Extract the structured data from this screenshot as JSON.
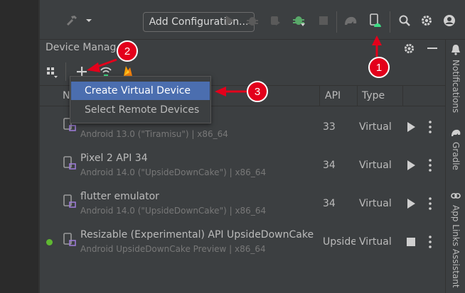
{
  "toolbar": {
    "add_configuration_label": "Add Configuration..."
  },
  "panel": {
    "title": "Device Manager"
  },
  "table": {
    "columns": [
      "N",
      "API",
      "Type"
    ],
    "rows": [
      {
        "name": "",
        "subtitle": "Android 13.0 (\"Tiramisu\") | x86_64",
        "api": "33",
        "type": "Virtual",
        "running": false
      },
      {
        "name": "Pixel 2 API 34",
        "subtitle": "Android 14.0 (\"UpsideDownCake\") | x86_64",
        "api": "34",
        "type": "Virtual",
        "running": false
      },
      {
        "name": "flutter emulator",
        "subtitle": "Android 14.0 (\"UpsideDownCake\") | x86_64",
        "api": "34",
        "type": "Virtual",
        "running": false
      },
      {
        "name": "Resizable (Experimental) API UpsideDownCake",
        "subtitle": "Android UpsideDownCake Preview | x86_64",
        "api": "UpsideDownCake",
        "type": "Virtual",
        "running": true
      }
    ]
  },
  "menu": {
    "items": [
      "Create Virtual Device",
      "Select Remote Devices"
    ]
  },
  "side_tabs": [
    "Notifications",
    "Gradle",
    "App Links Assistant"
  ],
  "annotations": [
    "1",
    "2",
    "3"
  ],
  "colors": {
    "accent": "#4b6eaf",
    "annotation": "#e3001b",
    "running": "#5fb832",
    "android_green": "#3ddc84"
  }
}
